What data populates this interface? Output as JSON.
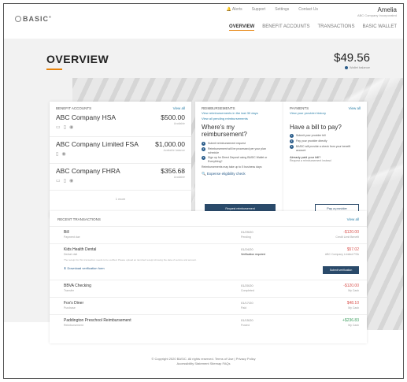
{
  "brand": {
    "logo": "BASIC",
    "mark": "®"
  },
  "header": {
    "links": [
      {
        "label": "Alerts",
        "icon": "bell-icon"
      },
      {
        "label": "Support"
      },
      {
        "label": "Settings"
      },
      {
        "label": "Contact Us"
      }
    ],
    "user_name": "Amelia",
    "user_sub": "ABC Company Incorporated",
    "nav": [
      "OVERVIEW",
      "BENEFIT ACCOUNTS",
      "TRANSACTIONS",
      "BASIC WALLET"
    ]
  },
  "overview": {
    "title": "OVERVIEW",
    "balance": "$49.56",
    "balance_sub": "Wallet balance"
  },
  "accounts": {
    "heading": "Benefit Accounts",
    "view_all": "View all",
    "items": [
      {
        "name": "ABC Company HSA",
        "amount": "$500.00",
        "amount_sub": "Available"
      },
      {
        "name": "ABC Company Limited FSA",
        "amount": "$1,000.00",
        "amount_sub": "Available balance"
      },
      {
        "name": "ABC Company FHRA",
        "amount": "$356.68",
        "amount_sub": "Available"
      }
    ],
    "more": "1 more"
  },
  "reimbursements": {
    "heading": "Reimbursements",
    "line1": "View reimbursements in the last 30 days",
    "line2": "View all pending reimbursements",
    "question": "Where's my reimbursement?",
    "steps": [
      "Submit reimbursement request",
      "Reimbursement will be processed per your plan schedule",
      "Sign up for Direct Deposit using BASIC Wallet or Everything?"
    ],
    "note": "Reimbursements may take up to 5 business days",
    "search": "Expense eligibility check",
    "button": "Request reimbursement"
  },
  "payments": {
    "heading": "Payments",
    "view_all": "View all",
    "line1": "View your provider history",
    "question": "Have a bill to pay?",
    "steps": [
      "Submit your provider bill",
      "Pay your provider directly",
      "BASIC will provide a check from your benefit account"
    ],
    "sub_heading": "Already paid your bill?",
    "sub_text": "Request a reimbursement instead",
    "button": "Pay a provider"
  },
  "transactions": {
    "heading": "Recent Transactions",
    "view_all": "View all",
    "rows": [
      {
        "name": "Bill",
        "sub": "Payment due",
        "mid": "01/29/20",
        "mid_sub": "Pending",
        "amount": "-$120.00",
        "amount_sub": "Credit Limit Benefit",
        "tone": "neg"
      },
      {
        "name": "Kids Health Dental",
        "sub": "Dental visit",
        "mid": "01/24/20",
        "mid_sub": "Verification required",
        "amount": "$57.02",
        "amount_sub": "ABC Company Limited FSA",
        "tone": "neg",
        "detail": "The receipt for this transaction needs to be verified. Please upload an itemized receipt showing the date of service and amount.",
        "download": "Download verification form",
        "button": "Submit verification"
      },
      {
        "name": "BBVA Checking",
        "sub": "Transfer",
        "mid": "01/20/20",
        "mid_sub": "Completed",
        "amount": "-$120.00",
        "amount_sub": "My Cash",
        "tone": "neg"
      },
      {
        "name": "Fox's Diner",
        "sub": "Purchase",
        "mid": "01/17/20",
        "mid_sub": "Paid",
        "amount": "$48.10",
        "amount_sub": "My Cash",
        "tone": "neg"
      },
      {
        "name": "Paddington Preschool Reimbursement",
        "sub": "Reimbursement",
        "mid": "01/15/20",
        "mid_sub": "Posted",
        "amount": "+$236.83",
        "amount_sub": "My Cash",
        "tone": "pos"
      }
    ]
  },
  "footer": {
    "line1": "© Copyright 2020 BASIC. All rights reserved. Terms of Use | Privacy Policy",
    "line2": "Accessibility Statement   Sitemap   FAQs"
  }
}
